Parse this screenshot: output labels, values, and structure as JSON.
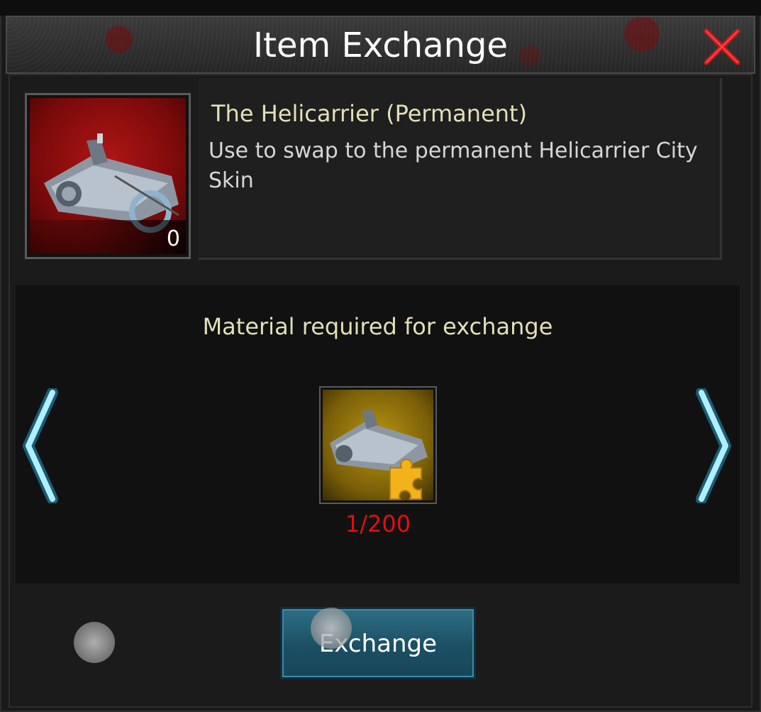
{
  "header": {
    "title": "Item Exchange",
    "close_icon": "close-x-icon"
  },
  "item": {
    "name": "The Helicarrier (Permanent)",
    "description": "Use to swap to the permanent Helicarrier City Skin",
    "owned_count": "0",
    "icon": "helicarrier-icon"
  },
  "material": {
    "heading": "Material required for exchange",
    "icon": "helicarrier-fragment-icon",
    "progress": "1/200",
    "progress_color": "#e01010"
  },
  "navigation": {
    "prev_icon": "chevron-left-icon",
    "next_icon": "chevron-right-icon"
  },
  "actions": {
    "exchange_label": "Exchange"
  },
  "colors": {
    "accent_text": "#e3dfb8",
    "close": "#d01818",
    "button": "#1c4f63",
    "arrow": "#7fdcff"
  }
}
